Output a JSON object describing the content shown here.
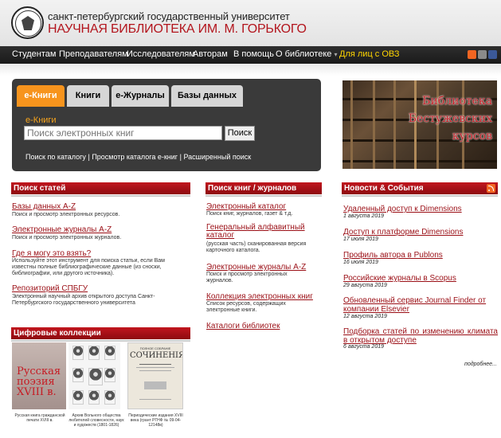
{
  "header": {
    "university": "санкт-петербургский государственный университет",
    "library": "НАУЧНАЯ БИБЛИОТЕКА ИМ. М. ГОРЬКОГО"
  },
  "nav": {
    "items": [
      "Студентам",
      "Преподавателям",
      "Исследователям",
      "Авторам",
      "В помощь",
      "О библиотеке"
    ],
    "dropdown_marker": "▾",
    "accessibility": "Для лиц с ОВЗ"
  },
  "search": {
    "tabs": [
      "e-Книги",
      "Книги",
      "e-Журналы",
      "Базы данных"
    ],
    "active_tab": "e-Книги",
    "label": "e-Книги",
    "placeholder": "Поиск электронных книг",
    "button": "Поиск",
    "links": [
      "Поиск по каталогу",
      "Просмотр каталога е-книг",
      "Расширенный поиск"
    ],
    "separator": "|"
  },
  "banner": {
    "line1": "Библиотека",
    "line2": "Бестужевских",
    "line3": "курсов"
  },
  "articles": {
    "title": "Поиск статей",
    "items": [
      {
        "link": "Базы данных A-Z",
        "desc": "Поиск и просмотр электронных ресурсов."
      },
      {
        "link": "Электронные журналы A-Z",
        "desc": "Поиск и просмотр электронных журналов."
      },
      {
        "link": "Где я могу это взять?",
        "desc": "Используйте этот инструмент для поиска статьи, если Вам известны полные библиографические данные (из сноски, библиографии, или другого источника)."
      },
      {
        "link": "Репозиторий СПБГУ",
        "desc": "Электронный научный архив открытого доступа Санкт-Петербургского государственного университета"
      }
    ]
  },
  "books": {
    "title": "Поиск книг / журналов",
    "items": [
      {
        "link": "Электронный каталог",
        "desc": "Поиск книг, журналов, газет & т.д."
      },
      {
        "link": "Генеральный алфавитный каталог",
        "desc": "(русская часть) сканированная версия карточного каталога."
      },
      {
        "link": "Электронные журналы A-Z",
        "desc": "Поиск и просмотр электронных журналов."
      },
      {
        "link": "Коллекция электронных книг",
        "desc": "Список ресурсов, содержащих электронные книги."
      },
      {
        "link": "Каталоги библиотек",
        "desc": ""
      }
    ]
  },
  "news": {
    "title": "Новости & События",
    "rss_icon": "rss-icon",
    "items": [
      {
        "link": "Удаленный доступ к Dimensions",
        "date": "1 августа 2019"
      },
      {
        "link": "Доступ к платформе Dimensions",
        "date": "17 июля 2019"
      },
      {
        "link": "Профиль автора в Publons",
        "date": "16 июля 2019"
      },
      {
        "link": "Российские журналы в Scopus",
        "date": "29 августа 2019"
      },
      {
        "link": "Обновленный сервис Journal Finder от компании Elsevier",
        "date": "12 августа 2019"
      },
      {
        "link": "Подборка статей по изменению климата в открытом доступе",
        "date": "6 августа 2019"
      }
    ],
    "more": "подробнее..."
  },
  "digital": {
    "title": "Цифровые коллекции",
    "poster_text": "Русская поэзия XVIII в.",
    "book_title": "СОЧИНЕНІЯ",
    "book_header": "ПОЛНОЕ СОБРАНІЕ",
    "captions": [
      "Русская книга гражданской печати XVIII в.",
      "Архив Вольного общества любителей словесности, наук и художеств (1801-1826)",
      "Периодические издания XVIII века (грант РГНФ № 09-04-12148в)"
    ]
  }
}
